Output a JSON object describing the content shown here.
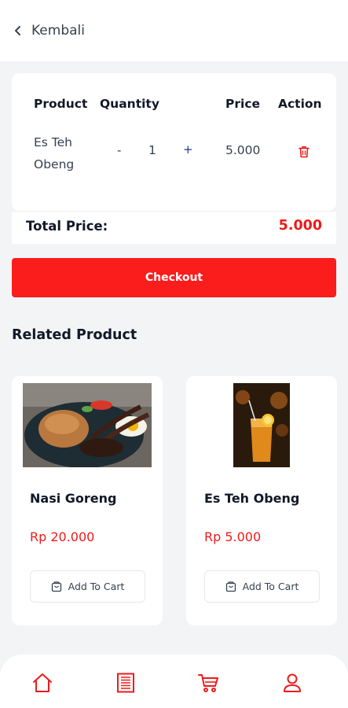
{
  "header": {
    "back_label": "Kembali"
  },
  "cart": {
    "columns": {
      "product": "Product",
      "quantity": "Quantity",
      "price": "Price",
      "action": "Action"
    },
    "row": {
      "product": "Es Teh Obeng",
      "minus": "-",
      "quantity": "1",
      "plus": "+",
      "price": "5.000"
    },
    "total_label": "Total Price:",
    "total_value": "5.000",
    "checkout_label": "Checkout"
  },
  "related": {
    "title": "Related Product",
    "products": [
      {
        "name": "Nasi Goreng",
        "price": "Rp 20.000",
        "button": "Add To Cart"
      },
      {
        "name": "Es Teh Obeng",
        "price": "Rp 5.000",
        "button": "Add To Cart"
      }
    ]
  },
  "nav": {
    "icons": [
      "home-icon",
      "orders-icon",
      "cart-icon",
      "profile-icon"
    ]
  },
  "colors": {
    "accent": "#fb1c1c",
    "price_red": "#ef1a1a",
    "background": "#f3f4f6"
  }
}
